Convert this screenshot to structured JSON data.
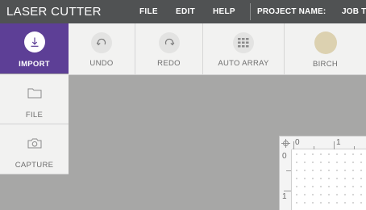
{
  "app": {
    "title": "LASER CUTTER"
  },
  "menu": {
    "file": "FILE",
    "edit": "EDIT",
    "help": "HELP"
  },
  "project": {
    "label": "PROJECT NAME:",
    "name": "JOB T"
  },
  "toolbar": {
    "undo": "UNDO",
    "redo": "REDO",
    "auto_array": "AUTO ARRAY",
    "material": "BIRCH",
    "material_color": "#dcd1b0"
  },
  "sidebar": {
    "import": "IMPORT",
    "file": "FILE",
    "capture": "CAPTURE",
    "active_color": "#5d3f96"
  },
  "ruler": {
    "top": [
      "0",
      "1"
    ],
    "left": [
      "0",
      "1"
    ]
  }
}
